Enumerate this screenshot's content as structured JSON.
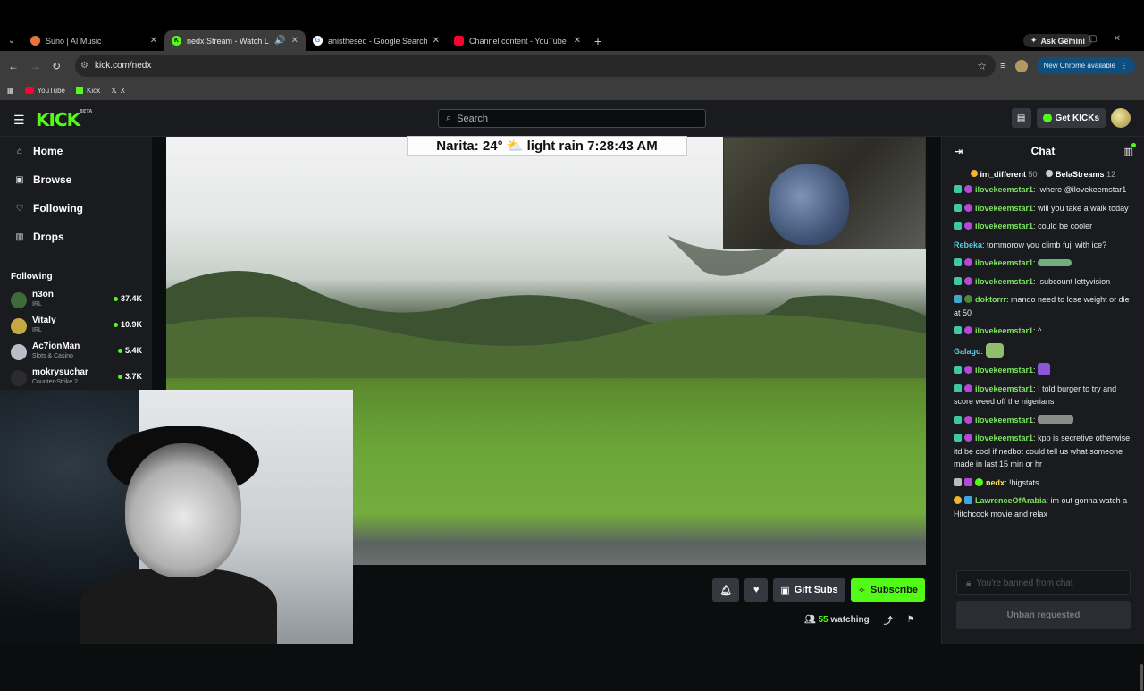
{
  "browser": {
    "tabs": [
      {
        "title": "Suno | AI Music",
        "icon": "suno-icon",
        "color": "#e8743a"
      },
      {
        "title": "nedx Stream - Watch Live o",
        "icon": "kick-icon",
        "color": "#53fc18",
        "active": true
      },
      {
        "title": "anisthesed - Google Search",
        "icon": "google-icon",
        "color": "#ffffff"
      },
      {
        "title": "Channel content - YouTube Stu",
        "icon": "youtube-icon",
        "color": "#ff0033"
      }
    ],
    "gemini_label": "Ask Gemini",
    "url": "kick.com/nedx",
    "new_chrome_label": "New Chrome available",
    "bookmarks": [
      {
        "label": "YouTube",
        "icon": "youtube-icon"
      },
      {
        "label": "Kick",
        "icon": "kick-icon"
      },
      {
        "label": "X",
        "icon": "x-icon"
      }
    ]
  },
  "header": {
    "logo": "KICK",
    "logo_badge": "BETA",
    "search_placeholder": "Search",
    "get_kicks_label": "Get KICKs"
  },
  "sidebar": {
    "nav": [
      {
        "label": "Home",
        "icon": "home-icon"
      },
      {
        "label": "Browse",
        "icon": "browse-icon"
      },
      {
        "label": "Following",
        "icon": "heart-icon"
      },
      {
        "label": "Drops",
        "icon": "drops-icon"
      }
    ],
    "following_title": "Following",
    "following": [
      {
        "name": "n3on",
        "category": "IRL",
        "viewers": "37.4K",
        "color": "#3f6a3a"
      },
      {
        "name": "Vitaly",
        "category": "IRL",
        "viewers": "10.9K",
        "color": "#c4a842"
      },
      {
        "name": "Ac7ionMan",
        "category": "Slots & Casino",
        "viewers": "5.4K",
        "color": "#bcbcc8"
      },
      {
        "name": "mokrysuchar",
        "category": "Counter-Strike 2",
        "viewers": "3.7K",
        "color": "#2c2c2c"
      }
    ]
  },
  "stream": {
    "weather_overlay": "Narita: 24° ⛅ light rain 7:28:43 AM",
    "gift_subs_label": "Gift Subs",
    "subscribe_label": "Subscribe",
    "watching_count": "55",
    "watching_label": "watching"
  },
  "chat": {
    "title": "Chat",
    "pinned": [
      {
        "name": "im_different",
        "count": "50"
      },
      {
        "name": "BelaStreams",
        "count": "12"
      }
    ],
    "messages": [
      {
        "user": "ilovekeemstar1",
        "text": "!where @ilovekeemstar1",
        "color": "green"
      },
      {
        "user": "ilovekeemstar1",
        "text": "will you take a walk today",
        "color": "green"
      },
      {
        "user": "ilovekeemstar1",
        "text": "could be cooler",
        "color": "green"
      },
      {
        "user": "Rebeka",
        "text": "tommorow you climb fuji with ice?",
        "color": "teal"
      },
      {
        "user": "ilovekeemstar1",
        "text": "",
        "color": "green"
      },
      {
        "user": "ilovekeemstar1",
        "text": "!subcount lettyvision",
        "color": "green"
      },
      {
        "user": "doktorrr",
        "text": "mando need to lose weight or die at 50",
        "color": "green"
      },
      {
        "user": "ilovekeemstar1",
        "text": "^",
        "color": "green"
      },
      {
        "user": "Galago",
        "text": "",
        "color": "teal"
      },
      {
        "user": "ilovekeemstar1",
        "text": "",
        "color": "green"
      },
      {
        "user": "ilovekeemstar1",
        "text": "I told burger to try and score weed off the nigerians",
        "color": "green"
      },
      {
        "user": "ilovekeemstar1",
        "text": "",
        "color": "green"
      },
      {
        "user": "ilovekeemstar1",
        "text": "kpp is secretive otherwise itd be cool if nedbot could tell us what someone made in last 15 min or hr",
        "color": "green"
      },
      {
        "user": "nedx",
        "text": "!bigstats",
        "color": "yellow"
      },
      {
        "user": "LawrenceOfArabia",
        "text": "im out gonna watch a Hitchcock movie and relax",
        "color": "green"
      }
    ],
    "input_placeholder": "You're banned from chat",
    "unban_label": "Unban requested"
  }
}
